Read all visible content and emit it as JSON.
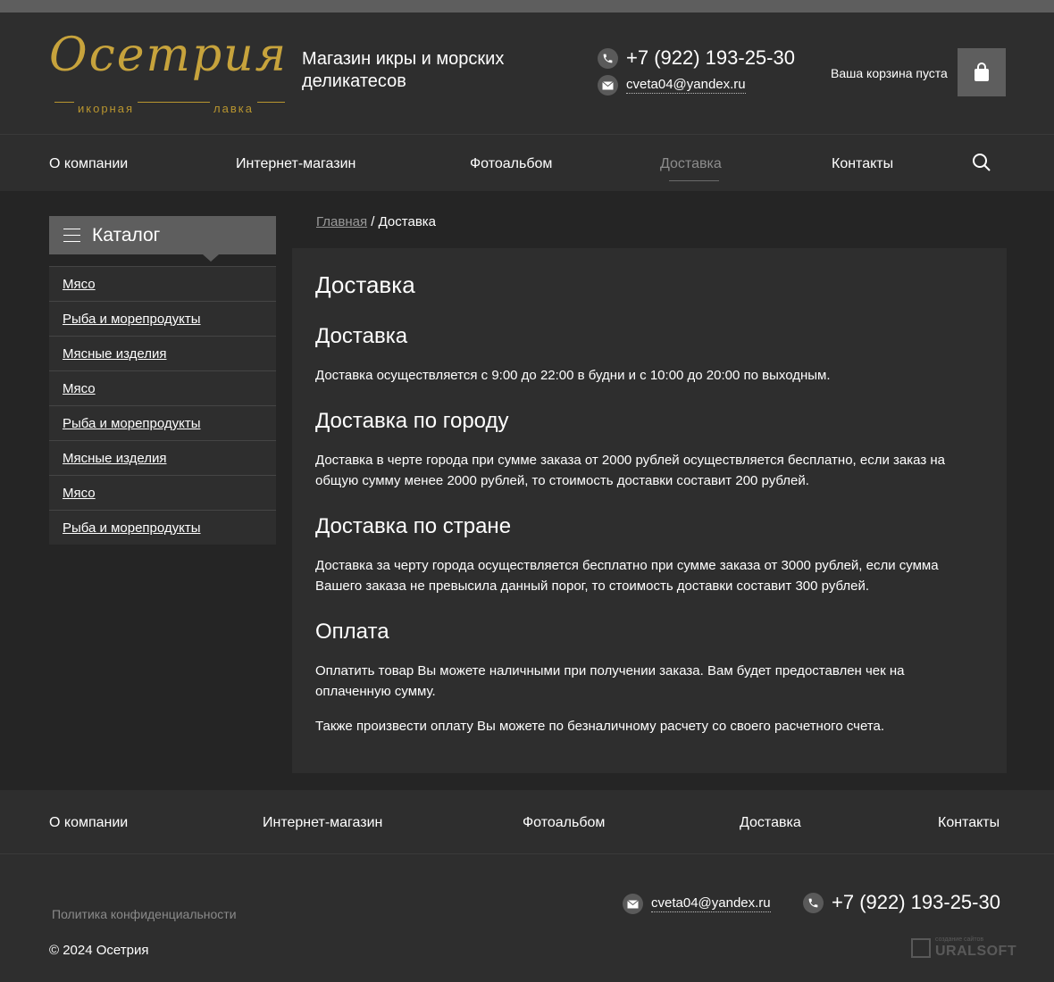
{
  "header": {
    "logo": {
      "script": "Осетрия",
      "sub_left": "икорная",
      "sub_right": "лавка"
    },
    "tagline": "Магазин икры и морских деликатесов",
    "phone": "+7 (922) 193-25-30",
    "email": "cveta04@yandex.ru",
    "cart_label": "Ваша корзина пуста"
  },
  "nav": {
    "items": [
      {
        "label": "О компании"
      },
      {
        "label": "Интернет-магазин"
      },
      {
        "label": "Фотоальбом"
      },
      {
        "label": "Доставка",
        "active": true
      },
      {
        "label": "Контакты"
      }
    ]
  },
  "sidebar": {
    "title": "Каталог",
    "items": [
      {
        "label": "Мясо"
      },
      {
        "label": "Рыба и морепродукты"
      },
      {
        "label": "Мясные изделия"
      },
      {
        "label": "Мясо"
      },
      {
        "label": "Рыба и морепродукты"
      },
      {
        "label": "Мясные изделия"
      },
      {
        "label": "Мясо"
      },
      {
        "label": "Рыба и морепродукты"
      }
    ]
  },
  "breadcrumb": {
    "home": "Главная",
    "separator": " / ",
    "current": "Доставка"
  },
  "content": {
    "title": "Доставка",
    "sections": [
      {
        "heading": "Доставка",
        "text": "Доставка осуществляется с 9:00 до 22:00 в будни и с 10:00 до 20:00 по выходным."
      },
      {
        "heading": "Доставка по городу",
        "text": "Доставка в черте города при сумме заказа от 2000 рублей осуществляется бесплатно, если заказ на общую сумму менее 2000 рублей, то стоимость доставки составит 200 рублей."
      },
      {
        "heading": "Доставка по стране",
        "text": "Доставка за черту города осуществляется бесплатно при сумме заказа от 3000 рублей, если сумма Вашего заказа не превысила данный порог, то стоимость доставки составит 300 рублей."
      },
      {
        "heading": "Оплата",
        "text": "Оплатить товар Вы можете наличными при получении заказа. Вам будет предоставлен чек на оплаченную сумму.",
        "text2": "Также произвести оплату Вы можете по безналичному расчету со своего расчетного счета."
      }
    ]
  },
  "footer": {
    "nav": [
      {
        "label": "О компании"
      },
      {
        "label": "Интернет-магазин"
      },
      {
        "label": "Фотоальбом"
      },
      {
        "label": "Доставка"
      },
      {
        "label": "Контакты"
      }
    ],
    "privacy": "Политика конфиденциальности",
    "copyright": "© 2024 Осетрия",
    "email": "cveta04@yandex.ru",
    "phone": "+7 (922) 193-25-30",
    "developer_small": "создание сайтов",
    "developer": "URALSOFT"
  },
  "colors": {
    "background": "#252525",
    "panel": "#2e2e2e",
    "accent_gold": "#c7a33c",
    "button_gray": "#5e5e5e"
  },
  "icons": [
    "phone-icon",
    "mail-icon",
    "shopping-bag-icon",
    "search-icon",
    "hamburger-icon"
  ]
}
